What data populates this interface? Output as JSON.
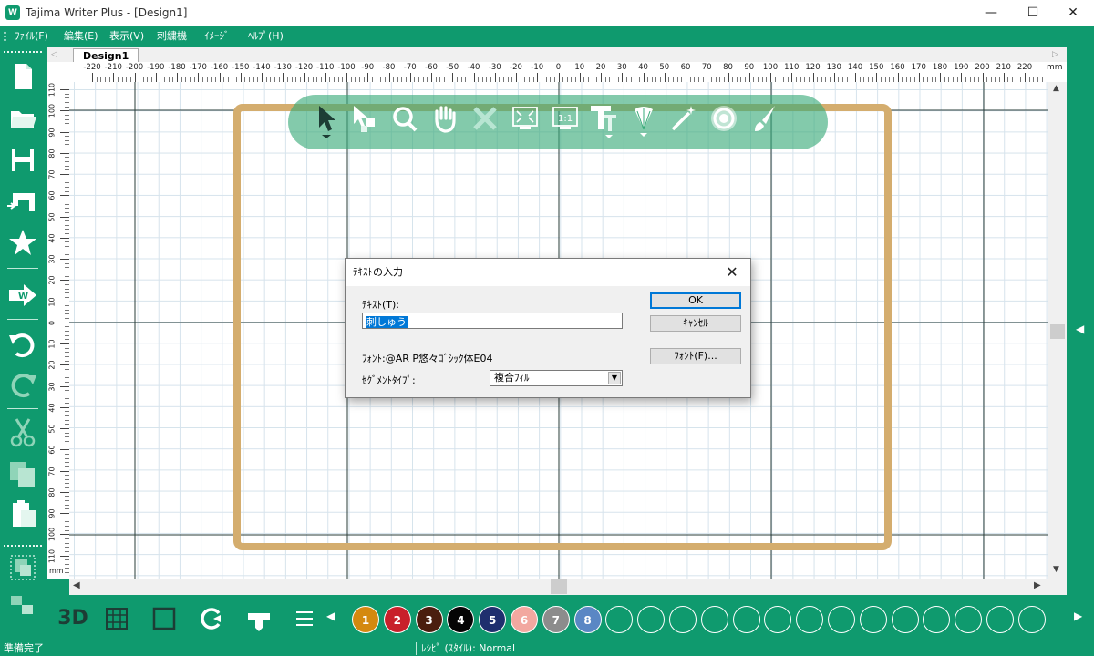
{
  "window": {
    "title": "Tajima Writer Plus - [Design1]",
    "app_icon_text": "W",
    "minimize": "—",
    "maximize": "☐",
    "close": "✕"
  },
  "menu": [
    "ﾌｧｲﾙ(F)",
    "編集(E)",
    "表示(V)",
    "刺繍機",
    "ｲﾒｰｼﾞ",
    "ﾍﾙﾌﾟ(H)"
  ],
  "tabs": {
    "document": "Design1"
  },
  "ruler": {
    "unit": "mm",
    "h_ticks": [
      "-220",
      "-210",
      "-200",
      "-190",
      "-180",
      "-170",
      "-160",
      "-150",
      "-140",
      "-130",
      "-120",
      "-110",
      "-100",
      "-90",
      "-80",
      "-70",
      "-60",
      "-50",
      "-40",
      "-30",
      "-20",
      "-10",
      "0",
      "10",
      "20",
      "30",
      "40",
      "50",
      "60",
      "70",
      "80",
      "90",
      "100",
      "110",
      "120",
      "130",
      "140",
      "150",
      "160",
      "170",
      "180",
      "190",
      "200",
      "210",
      "220"
    ],
    "v_ticks": [
      "110",
      "100",
      "90",
      "80",
      "70",
      "60",
      "50",
      "40",
      "30",
      "20",
      "10",
      "0",
      "10",
      "20",
      "30",
      "40",
      "50",
      "60",
      "70",
      "80",
      "90",
      "100",
      "110"
    ],
    "v_unit": "mm"
  },
  "dialog": {
    "title": "ﾃｷｽﾄの入力",
    "close": "✕",
    "text_label": "ﾃｷｽﾄ(T):",
    "text_value": "刺しゅう",
    "font_label": "ﾌｫﾝﾄ:@AR P悠々ｺﾞｼｯｸ体E04",
    "segment_label": "ｾｸﾞﾒﾝﾄﾀｲﾌﾟ:",
    "segment_value": "複合ﾌｨﾙ",
    "ok": "OK",
    "cancel": "ｷｬﾝｾﾙ",
    "font_button": "ﾌｫﾝﾄ(F)..."
  },
  "bottom": {
    "label_3d": "3D",
    "colors": [
      {
        "label": "1",
        "color": "#d4890f"
      },
      {
        "label": "2",
        "color": "#c8202a"
      },
      {
        "label": "3",
        "color": "#4a1e0e"
      },
      {
        "label": "4",
        "color": "#050505"
      },
      {
        "label": "5",
        "color": "#1f2f6e"
      },
      {
        "label": "6",
        "color": "#f2a8a0"
      },
      {
        "label": "7",
        "color": "#8c8c8c"
      },
      {
        "label": "8",
        "color": "#5a87c4"
      }
    ],
    "empty_slots": 14
  },
  "status": {
    "ready": "準備完了",
    "recipe": "ﾚｼﾋﾟ (ｽﾀｲﾙ): Normal"
  },
  "colors": {
    "accent": "#0f9a6e",
    "hoop": "#d4ad6e",
    "grid_major": "#2a3d3a"
  }
}
